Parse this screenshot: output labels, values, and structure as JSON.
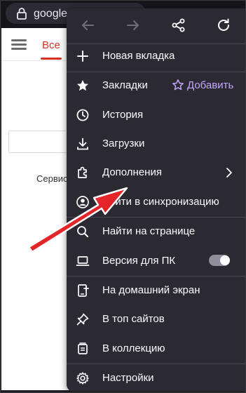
{
  "address_bar": {
    "url": "google.com",
    "lock_icon": "lock-icon"
  },
  "page": {
    "tab_label": "Все",
    "services_text": "Сервисы",
    "accent_color": "#d93025"
  },
  "menu": {
    "nav_icons": [
      "back-arrow-icon",
      "forward-arrow-icon",
      "share-icon",
      "reload-icon"
    ],
    "items": [
      {
        "id": "new-tab",
        "label": "Новая вкладка",
        "icon": "plus-icon"
      },
      {
        "id": "bookmarks",
        "label": "Закладки",
        "icon": "star-filled-icon",
        "action_label": "Добавить",
        "action_icon": "star-outline-icon"
      },
      {
        "id": "history",
        "label": "История",
        "icon": "clock-icon"
      },
      {
        "id": "downloads",
        "label": "Загрузки",
        "icon": "download-icon"
      },
      {
        "id": "addons",
        "label": "Дополнения",
        "icon": "puzzle-icon",
        "trailing_icon": "chevron-right-icon"
      },
      {
        "id": "sync",
        "label": "Войти в синхронизацию",
        "icon": "account-icon"
      },
      {
        "id": "find",
        "label": "Найти на странице",
        "icon": "search-icon"
      },
      {
        "id": "desktop",
        "label": "Версия для ПК",
        "icon": "laptop-icon",
        "toggle_on": false
      },
      {
        "id": "home-screen",
        "label": "На домашний экран",
        "icon": "add-to-home-icon"
      },
      {
        "id": "top-sites",
        "label": "В топ сайтов",
        "icon": "pin-icon"
      },
      {
        "id": "collection",
        "label": "В коллекцию",
        "icon": "collection-icon"
      },
      {
        "id": "settings",
        "label": "Настройки",
        "icon": "gear-icon"
      }
    ],
    "accent_color": "#c5a7ff",
    "background": "#2b2a33"
  },
  "annotation": {
    "arrow_color": "#e0141e"
  }
}
